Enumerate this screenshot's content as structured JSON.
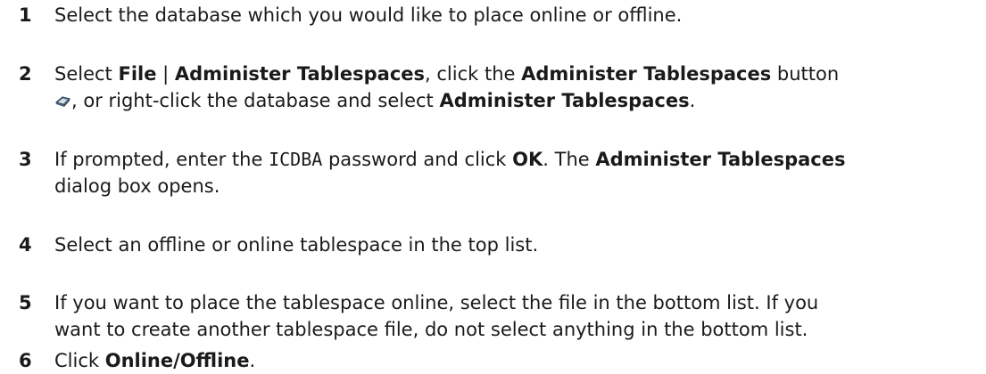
{
  "steps": [
    {
      "number": "1",
      "text": "Select the database which you would like to place online or offline."
    },
    {
      "number": "2",
      "t1": "Select ",
      "b1": "File",
      "t2": " | ",
      "b2": "Administer Tablespaces",
      "t3": ", click the ",
      "b3": "Administer Tablespaces",
      "t4": " button",
      "icon": "administer-tablespaces-icon",
      "t5": ", or right-click the database and select ",
      "b4": "Administer Tablespaces",
      "t6": "."
    },
    {
      "number": "3",
      "t1": "If prompted, enter the ",
      "code": "ICDBA",
      "t2": " password and click ",
      "b1": "OK",
      "t3": ". The ",
      "b2": "Administer Tablespaces",
      "t4": "dialog box opens."
    },
    {
      "number": "4",
      "text": "Select an offline or online tablespace in the top list."
    },
    {
      "number": "5",
      "line1": "If you want to place the tablespace online, select the file in the bottom list. If you",
      "line2": "want to create another tablespace file, do not select anything in the bottom list."
    },
    {
      "number": "6",
      "t1": "Click ",
      "b1": "Online/Offline",
      "t2": "."
    }
  ]
}
